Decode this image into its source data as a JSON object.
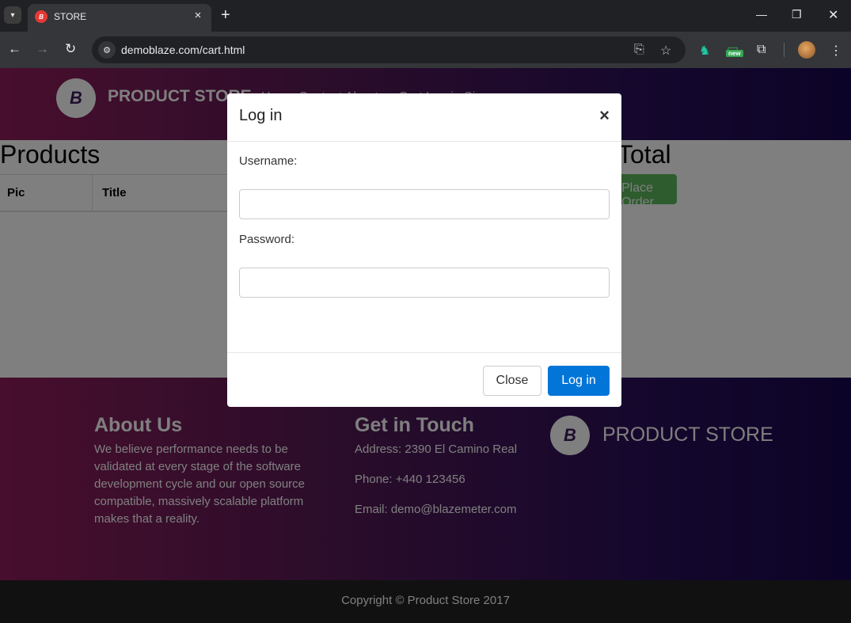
{
  "browser": {
    "tab_title": "STORE",
    "url": "demoblaze.com/cart.html",
    "new_badge": "new",
    "favicon_text": "B"
  },
  "site": {
    "brand": "PRODUCT STORE",
    "logo_letter": "B",
    "nav_hint": "Home  Contact  About us  Cart  Log in  Sign up"
  },
  "cart": {
    "products_heading": "Products",
    "columns": [
      "Pic",
      "Title"
    ],
    "total_heading": "Total",
    "place_order_label": "Place Order"
  },
  "modal": {
    "title": "Log in",
    "close_symbol": "×",
    "username_label": "Username:",
    "username_value": "",
    "password_label": "Password:",
    "password_value": "",
    "close_button": "Close",
    "login_button": "Log in"
  },
  "footer": {
    "about_heading": "About Us",
    "about_text": "We believe performance needs to be validated at every stage of the software development cycle and our open source compatible, massively scalable platform makes that a reality.",
    "contact_heading": "Get in Touch",
    "address": "Address: 2390 El Camino Real",
    "phone": "Phone: +440 123456",
    "email": "Email: demo@blazemeter.com",
    "brand": "PRODUCT STORE",
    "copyright": "Copyright © Product Store 2017"
  },
  "colors": {
    "hero_gradient_start": "#901d5a",
    "hero_gradient_end": "#180850",
    "login_button": "#0275d8",
    "place_order": "#5cb85c"
  }
}
